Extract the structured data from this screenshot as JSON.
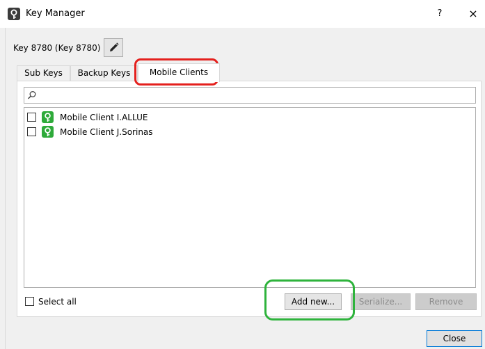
{
  "window": {
    "title": "Key Manager",
    "help_label": "?",
    "close_label": "×",
    "app_icon": "key-icon"
  },
  "key": {
    "label": "Key 8780 (Key 8780)",
    "edit_icon": "pencil-icon"
  },
  "tabs": [
    {
      "label": "Sub Keys",
      "active": false
    },
    {
      "label": "Backup Keys",
      "active": false
    },
    {
      "label": "Mobile Clients",
      "active": true
    }
  ],
  "search": {
    "value": "",
    "placeholder": "",
    "icon": "search-icon"
  },
  "list": {
    "items": [
      {
        "label": "Mobile Client I.ALLUE",
        "checked": false,
        "icon": "mobile-key-icon"
      },
      {
        "label": "Mobile Client J.Sorinas",
        "checked": false,
        "icon": "mobile-key-icon"
      }
    ]
  },
  "select_all": {
    "label": "Select all",
    "checked": false
  },
  "buttons": {
    "add_new": "Add new...",
    "serialize": "Serialize...",
    "remove": "Remove",
    "close": "Close"
  },
  "colors": {
    "annotation_red": "#e4201d",
    "annotation_green": "#2eb33c",
    "mobile_icon_green": "#2eaa3a",
    "accent_blue": "#0078d7"
  }
}
